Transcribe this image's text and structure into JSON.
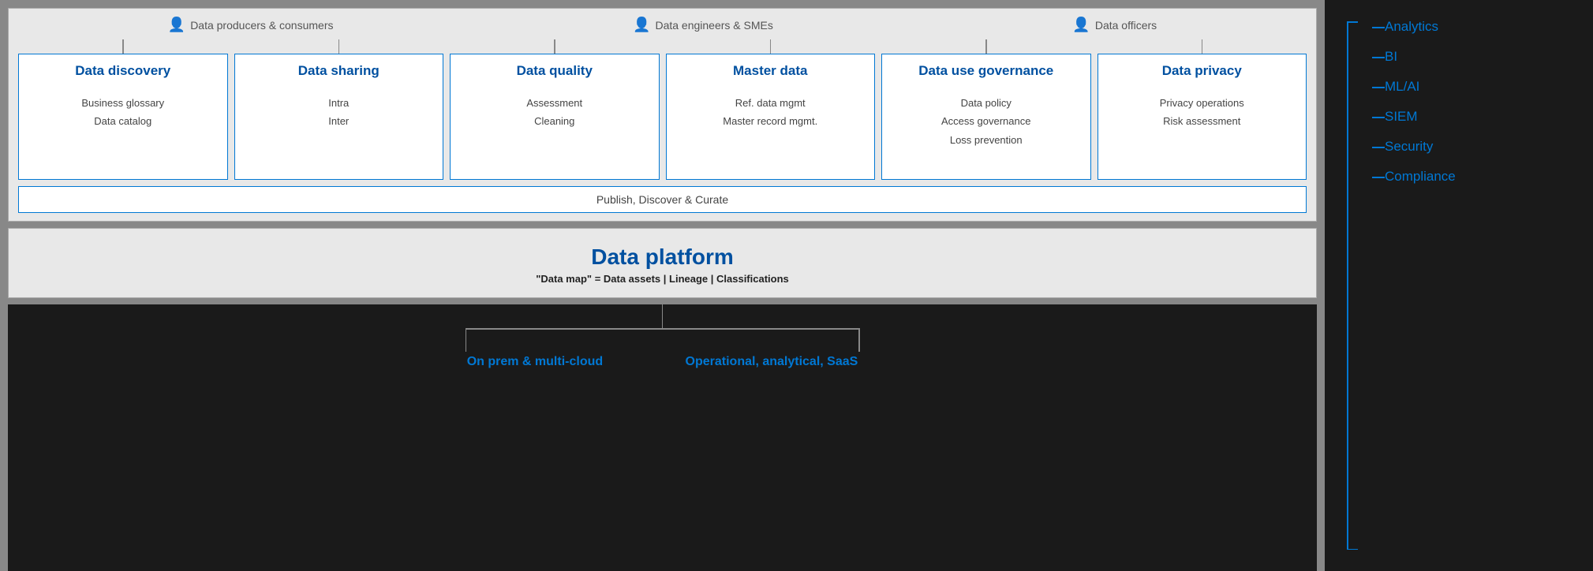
{
  "personas": [
    {
      "label": "Data producers & consumers",
      "icon": "👤"
    },
    {
      "label": "Data engineers & SMEs",
      "icon": "👤"
    },
    {
      "label": "Data officers",
      "icon": "👤"
    }
  ],
  "dataBoxes": [
    {
      "title": "Data discovery",
      "items": [
        "Business glossary",
        "Data catalog"
      ]
    },
    {
      "title": "Data sharing",
      "items": [
        "Intra",
        "Inter"
      ]
    },
    {
      "title": "Data quality",
      "items": [
        "Assessment",
        "Cleaning"
      ]
    },
    {
      "title": "Master data",
      "items": [
        "Ref. data mgmt",
        "Master record mgmt."
      ]
    },
    {
      "title": "Data use governance",
      "items": [
        "Data policy",
        "Access governance",
        "Loss prevention"
      ]
    },
    {
      "title": "Data privacy",
      "items": [
        "Privacy operations",
        "Risk assessment"
      ]
    }
  ],
  "publishBar": "Publish, Discover & Curate",
  "platform": {
    "title": "Data platform",
    "subtitle": "\"Data map\" = Data assets | Lineage | Classifications"
  },
  "bottomBranches": [
    "On prem & multi-cloud",
    "Operational, analytical, SaaS"
  ],
  "sidebar": {
    "items": [
      "Analytics",
      "BI",
      "ML/AI",
      "SIEM",
      "Security",
      "Compliance"
    ]
  }
}
